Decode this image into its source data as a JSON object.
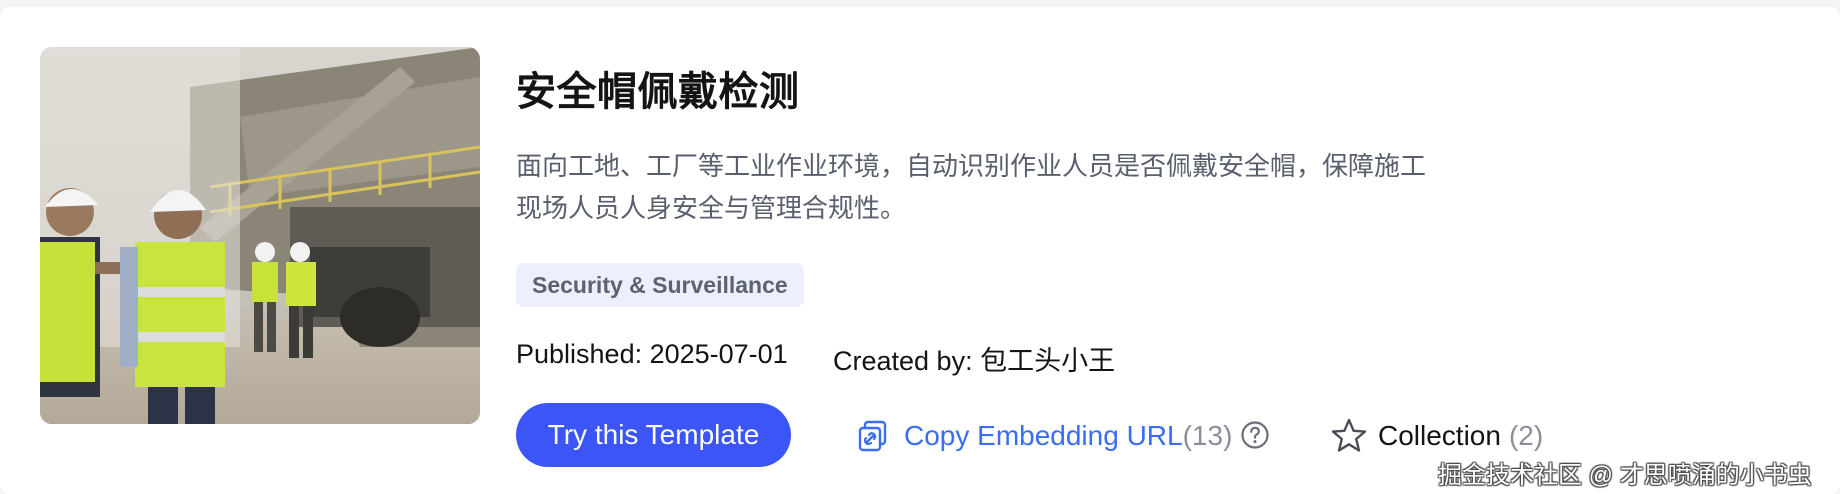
{
  "template": {
    "title": "安全帽佩戴检测",
    "description": "面向工地、工厂等工业作业环境，自动识别作业人员是否佩戴安全帽，保障施工现场人员人身安全与管理合规性。",
    "tag": "Security & Surveillance",
    "published": "Published: 2025-07-01",
    "created_by": "Created by: 包工头小王"
  },
  "actions": {
    "try_label": "Try this Template",
    "copy_label": "Copy Embedding URL",
    "copy_count": "(13)",
    "collection_label": "Collection",
    "collection_count": "(2)"
  },
  "icons": {
    "copy": "link-copy-icon",
    "help": "question-circle-icon",
    "collection": "star-outline-icon"
  },
  "colors": {
    "primary_button": "#3b55f6",
    "link": "#3a6cf4",
    "tag_background": "#eceffd",
    "muted": "#8a8f99"
  },
  "watermark": "掘金技术社区 @ 才思喷涌的小书虫"
}
